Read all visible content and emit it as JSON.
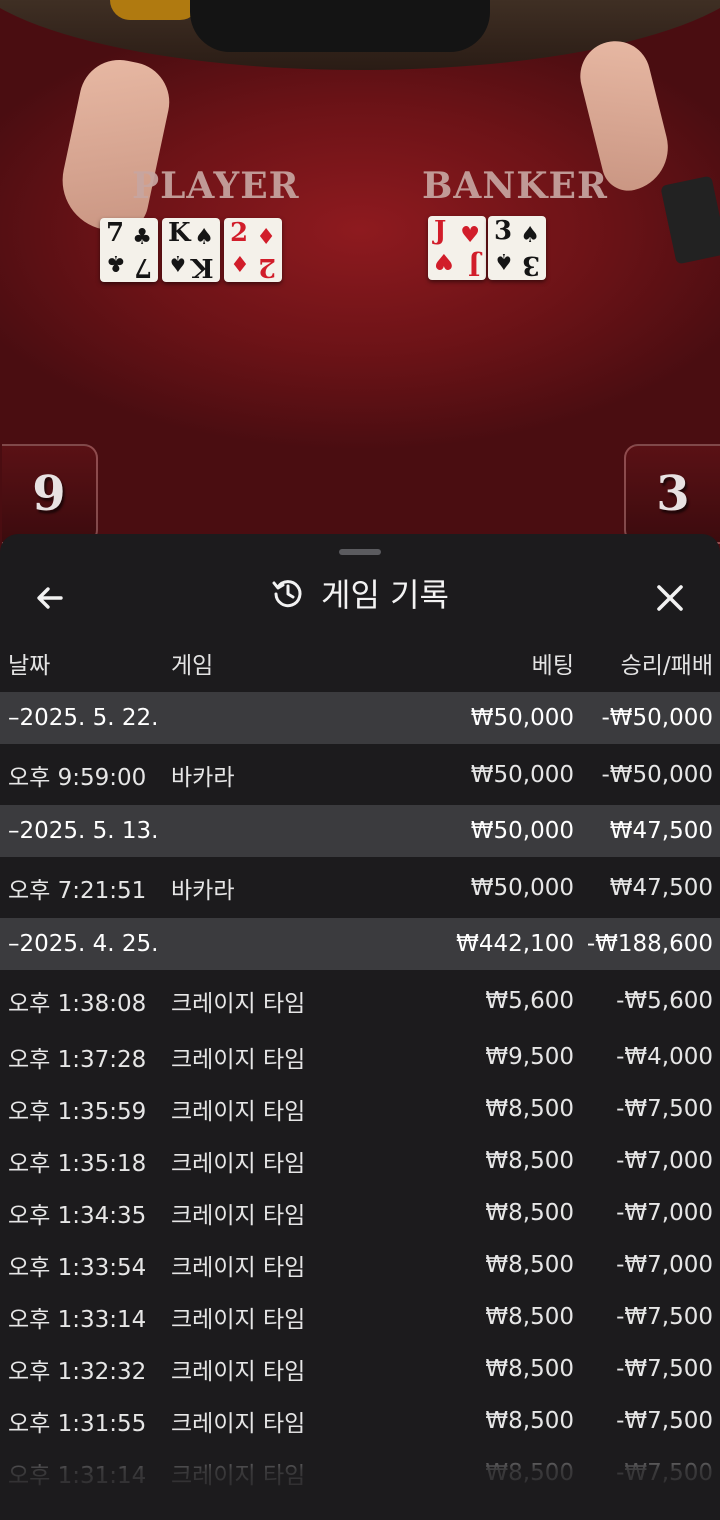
{
  "table": {
    "player_label": "PLAYER",
    "banker_label": "BANKER",
    "player_cards": [
      {
        "rank": "7",
        "suit": "♣",
        "color": "black"
      },
      {
        "rank": "K",
        "suit": "♠",
        "color": "black"
      },
      {
        "rank": "2",
        "suit": "♦",
        "color": "red"
      }
    ],
    "banker_cards": [
      {
        "rank": "J",
        "suit": "♥",
        "color": "red"
      },
      {
        "rank": "3",
        "suit": "♠",
        "color": "black"
      }
    ],
    "player_score": "9",
    "banker_score": "3"
  },
  "sheet": {
    "title": "게임 기록",
    "back_icon": "arrow-left-icon",
    "history_icon": "history-icon",
    "close_icon": "close-icon",
    "columns": {
      "date": "날짜",
      "game": "게임",
      "bet": "베팅",
      "result": "승리/패배"
    }
  },
  "rows": [
    {
      "type": "group",
      "date": "–2025. 5. 22.",
      "game": "",
      "bet": "₩50,000",
      "result": "-₩50,000"
    },
    {
      "type": "item",
      "date": "오후 9:59:00",
      "game": "바카라",
      "bet": "₩50,000",
      "result": "-₩50,000"
    },
    {
      "type": "group",
      "date": "–2025. 5. 13.",
      "game": "",
      "bet": "₩50,000",
      "result": "₩47,500"
    },
    {
      "type": "item",
      "date": "오후 7:21:51",
      "game": "바카라",
      "bet": "₩50,000",
      "result": "₩47,500"
    },
    {
      "type": "group",
      "date": "–2025. 4. 25.",
      "game": "",
      "bet": "₩442,100",
      "result": "-₩188,600"
    },
    {
      "type": "item",
      "date": "오후 1:38:08",
      "game": "크레이지 타임",
      "bet": "₩5,600",
      "result": "-₩5,600"
    },
    {
      "type": "item",
      "date": "오후 1:37:28",
      "game": "크레이지 타임",
      "bet": "₩9,500",
      "result": "-₩4,000"
    },
    {
      "type": "item",
      "date": "오후 1:35:59",
      "game": "크레이지 타임",
      "bet": "₩8,500",
      "result": "-₩7,500"
    },
    {
      "type": "item",
      "date": "오후 1:35:18",
      "game": "크레이지 타임",
      "bet": "₩8,500",
      "result": "-₩7,000"
    },
    {
      "type": "item",
      "date": "오후 1:34:35",
      "game": "크레이지 타임",
      "bet": "₩8,500",
      "result": "-₩7,000"
    },
    {
      "type": "item",
      "date": "오후 1:33:54",
      "game": "크레이지 타임",
      "bet": "₩8,500",
      "result": "-₩7,000"
    },
    {
      "type": "item",
      "date": "오후 1:33:14",
      "game": "크레이지 타임",
      "bet": "₩8,500",
      "result": "-₩7,500"
    },
    {
      "type": "item",
      "date": "오후 1:32:32",
      "game": "크레이지 타임",
      "bet": "₩8,500",
      "result": "-₩7,500"
    },
    {
      "type": "item",
      "date": "오후 1:31:55",
      "game": "크레이지 타임",
      "bet": "₩8,500",
      "result": "-₩7,500"
    },
    {
      "type": "item",
      "date": "오후 1:31:14",
      "game": "크레이지 타임",
      "bet": "₩8,500",
      "result": "-₩7,500"
    }
  ]
}
